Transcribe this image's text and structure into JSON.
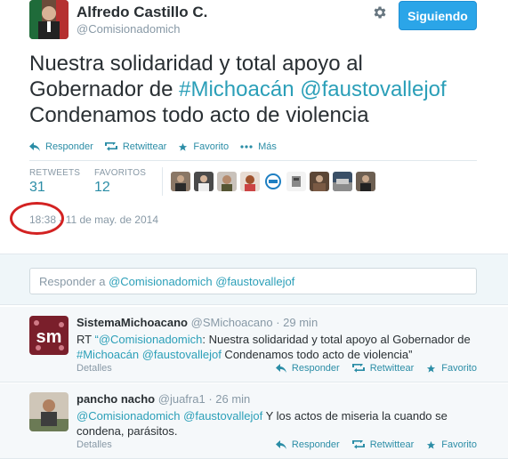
{
  "tweet": {
    "fullname": "Alfredo Castillo C.",
    "username": "@Comisionadomich",
    "follow_label": "Siguiendo",
    "text_line1": "Nuestra solidaridad y total apoyo al",
    "text_line2_prefix": "Gobernador de ",
    "hashtag": "#Michoacán",
    "mention": "@faustovallejof",
    "text_line3": "Condenamos todo acto de violencia",
    "actions": {
      "reply": "Responder",
      "retweet": "Retwittear",
      "favorite": "Favorito",
      "more": "Más"
    },
    "stats": {
      "retweets_label": "RETWEETS",
      "retweets_value": "31",
      "favorites_label": "FAVORITOS",
      "favorites_value": "12"
    },
    "time": "18:38",
    "date": "11 de may. de 2014"
  },
  "reply_box": {
    "prefix": "Responder a ",
    "mention1": "@Comisionadomich",
    "mention2": "@faustovallejof"
  },
  "replies": [
    {
      "name": "SistemaMichoacano",
      "username": "@SMichoacano",
      "time": "· 29 min",
      "avatar_text": "sm",
      "text_rt": "RT ",
      "text_q": "“",
      "text_mention": "@Comisionadomich",
      "text_after": ": Nuestra solidaridad y total apoyo al Gobernador de",
      "text_hashtag": "#Michoacán",
      "text_mention2": "@faustovallejof",
      "text_end": " Condenamos todo acto de violencia”",
      "details": "Detalles"
    },
    {
      "name": "pancho nacho",
      "username": "@juafra1",
      "time": "· 26 min",
      "text_mention": "@Comisionadomich",
      "text_mention2": "@faustovallejof",
      "text_after": " Y los actos de miseria la cuando se",
      "text_line2": "condena, parásitos.",
      "details": "Detalles"
    }
  ],
  "colors": {
    "accent": "#2b9fb8",
    "follow_button": "#2ba5e8",
    "annotation_red": "#d32222"
  }
}
